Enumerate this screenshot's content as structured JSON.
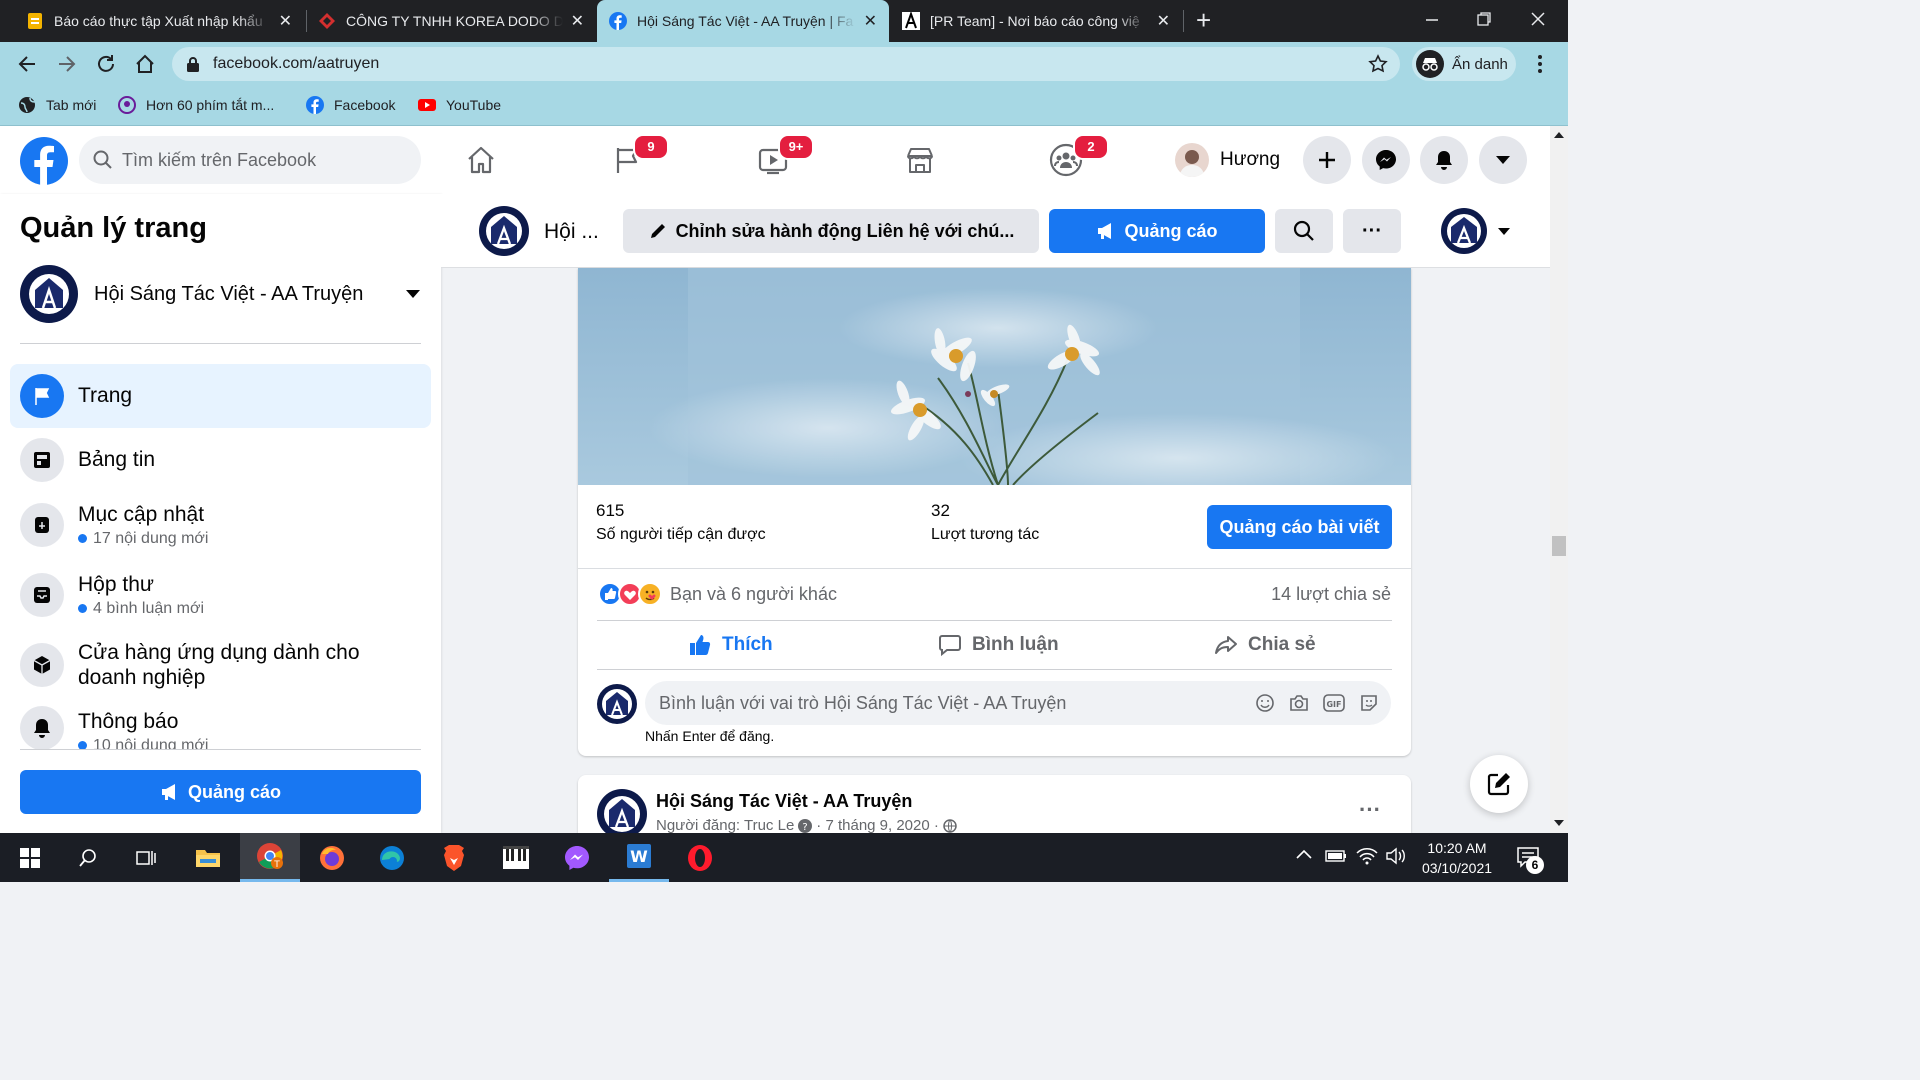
{
  "browser": {
    "tabs": [
      {
        "title": "Báo cáo thực tập Xuất nhập khẩu",
        "close": "✕"
      },
      {
        "title": "CÔNG TY TNHH KOREA DODO D",
        "close": "✕"
      },
      {
        "title": "Hội Sáng Tác Việt - AA Truyện | Fa",
        "close": "✕"
      },
      {
        "title": "[PR Team] - Nơi báo cáo công việ",
        "close": "✕"
      }
    ],
    "new_tab": "+",
    "url": "facebook.com/aatruyen",
    "profile_label": "Ẩn danh",
    "bookmarks": [
      {
        "label": "Tab mới"
      },
      {
        "label": "Hơn 60 phím tắt m..."
      },
      {
        "label": "Facebook"
      },
      {
        "label": "YouTube"
      }
    ]
  },
  "fb": {
    "search_placeholder": "Tìm kiếm trên Facebook",
    "nav_badges": {
      "pages": "9",
      "watch": "9+",
      "groups": "2"
    },
    "user_name": "Hương"
  },
  "sidebar": {
    "title": "Quản lý trang",
    "page_name": "Hội Sáng Tác Việt - AA Truyện",
    "items": [
      {
        "label": "Trang",
        "sub": ""
      },
      {
        "label": "Bảng tin",
        "sub": ""
      },
      {
        "label": "Mục cập nhật",
        "sub": "17 nội dung mới"
      },
      {
        "label": "Hộp thư",
        "sub": "4 bình luận mới"
      },
      {
        "label": "Cửa hàng ứng dụng dành cho doanh nghiệp",
        "sub": ""
      },
      {
        "label": "Thông báo",
        "sub": "10 nội dung mới"
      }
    ],
    "ad_button": "Quảng cáo"
  },
  "page_header": {
    "name": "Hội ...",
    "edit_button": "Chỉnh sửa hành động Liên hệ với chú...",
    "ad_button": "Quảng cáo",
    "more": "···"
  },
  "post": {
    "reach_value": "615",
    "reach_label": "Số người tiếp cận được",
    "engagement_value": "32",
    "engagement_label": "Lượt tương tác",
    "boost_button": "Quảng cáo bài viết",
    "reactions_text": "Bạn và 6 người khác",
    "shares_text": "14 lượt chia sẻ",
    "like": "Thích",
    "comment": "Bình luận",
    "share": "Chia sẻ",
    "comment_placeholder": "Bình luận với vai trò Hội Sáng Tác Việt - AA Truyện",
    "enter_hint": "Nhấn Enter để đăng."
  },
  "post2": {
    "author": "Hội Sáng Tác Việt - AA Truyện",
    "meta": "Người đăng: Truc Le",
    "date": "7 tháng 9, 2020",
    "more": "···"
  },
  "taskbar": {
    "time": "10:20 AM",
    "date": "03/10/2021",
    "notif_count": "6"
  },
  "colors": {
    "fb_blue": "#1877f2",
    "browser_bar": "#a7d8e4",
    "badge_red": "#e41e3f"
  }
}
